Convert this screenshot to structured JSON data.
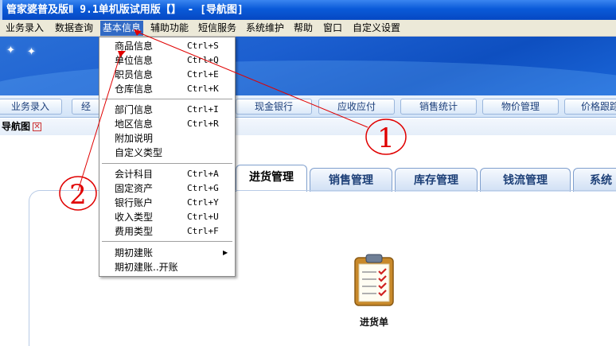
{
  "window": {
    "title": "管家婆普及版Ⅱ 9.1单机版试用版【】 - [导航图]"
  },
  "menubar": {
    "items": [
      "业务录入",
      "数据查询",
      "基本信息",
      "辅助功能",
      "短信服务",
      "系统维护",
      "帮助",
      "窗口",
      "自定义设置"
    ]
  },
  "toolbar": {
    "buttons": [
      "业务录入",
      "经",
      "现金银行",
      "应收应付",
      "销售统计",
      "物价管理",
      "价格跟踪"
    ]
  },
  "navigator": {
    "title": "导航图",
    "close_symbol": "☒"
  },
  "module_tabs": [
    "进货管理",
    "销售管理",
    "库存管理",
    "钱流管理",
    "系统"
  ],
  "module_tabs_selected": "进货管理",
  "shortcut": {
    "label": "进货单",
    "icon": "clipboard-checklist-icon"
  },
  "dropdown": {
    "group1": [
      {
        "label": "商品信息",
        "shortcut": "Ctrl+S"
      },
      {
        "label": "单位信息",
        "shortcut": "Ctrl+Q"
      },
      {
        "label": "职员信息",
        "shortcut": "Ctrl+E"
      },
      {
        "label": "仓库信息",
        "shortcut": "Ctrl+K"
      }
    ],
    "group2": [
      {
        "label": "部门信息",
        "shortcut": "Ctrl+I"
      },
      {
        "label": "地区信息",
        "shortcut": "Ctrl+R"
      },
      {
        "label": "附加说明",
        "shortcut": ""
      },
      {
        "label": "自定义类型",
        "shortcut": ""
      }
    ],
    "group3": [
      {
        "label": "会计科目",
        "shortcut": "Ctrl+A"
      },
      {
        "label": "固定资产",
        "shortcut": "Ctrl+G"
      },
      {
        "label": "银行账户",
        "shortcut": "Ctrl+Y"
      },
      {
        "label": "收入类型",
        "shortcut": "Ctrl+U"
      },
      {
        "label": "费用类型",
        "shortcut": "Ctrl+F"
      }
    ],
    "group4": [
      {
        "label": "期初建账",
        "has_submenu": true
      },
      {
        "label": "期初建账..开账"
      }
    ]
  },
  "annotations": {
    "marker1": "1",
    "marker2": "2",
    "color": "#e00000"
  }
}
